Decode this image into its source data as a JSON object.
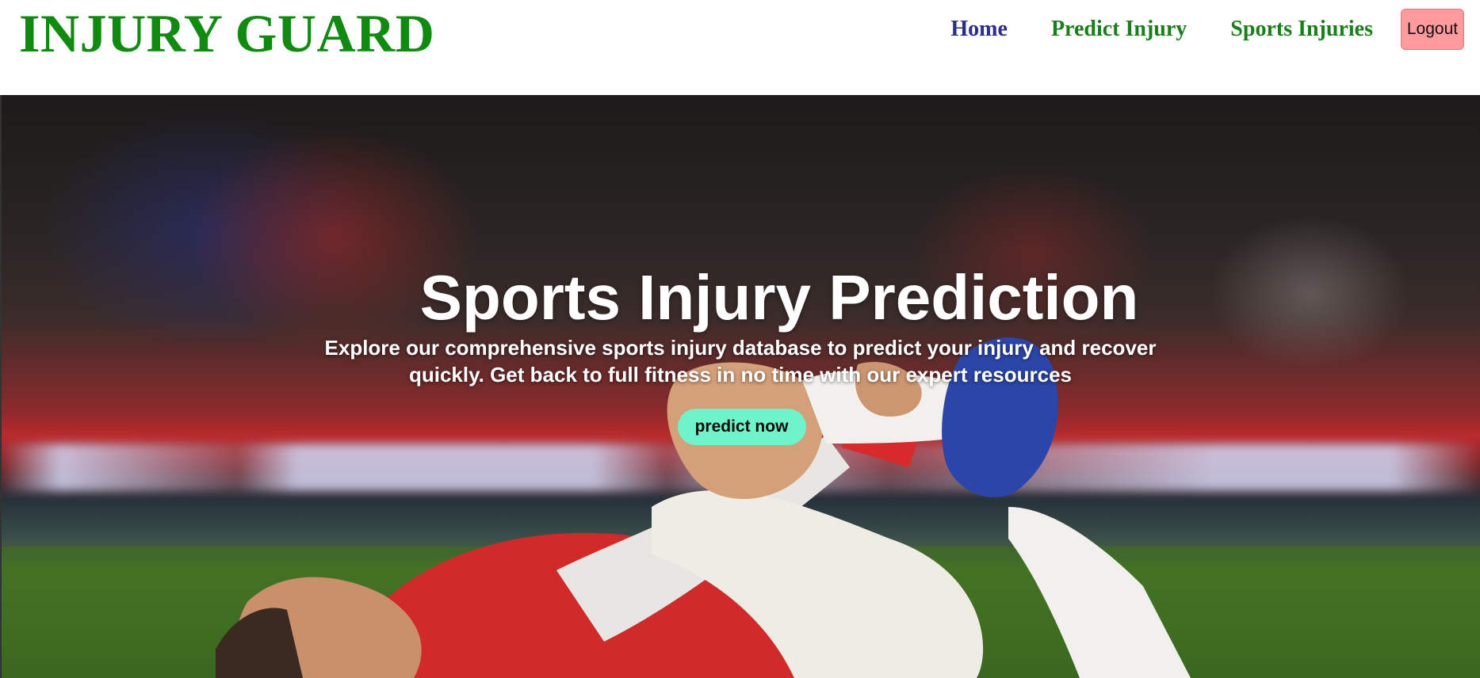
{
  "header": {
    "logo": "INJURY GUARD",
    "nav": [
      {
        "label": "Home",
        "active": true
      },
      {
        "label": "Predict Injury",
        "active": false
      },
      {
        "label": "Sports Injuries",
        "active": false
      }
    ],
    "logout_label": "Logout"
  },
  "hero": {
    "title": "Sports Injury Prediction",
    "text": "Explore our comprehensive sports injury database to predict your injury and recover quickly. Get back to full fitness in no time with our expert resources",
    "cta_label": "predict now"
  },
  "colors": {
    "logo": "#118a11",
    "nav_link": "#1a7f1a",
    "nav_active": "#2b2f8a",
    "logout_bg": "#ff9a9e",
    "cta_bg": "#6ff3c8"
  }
}
